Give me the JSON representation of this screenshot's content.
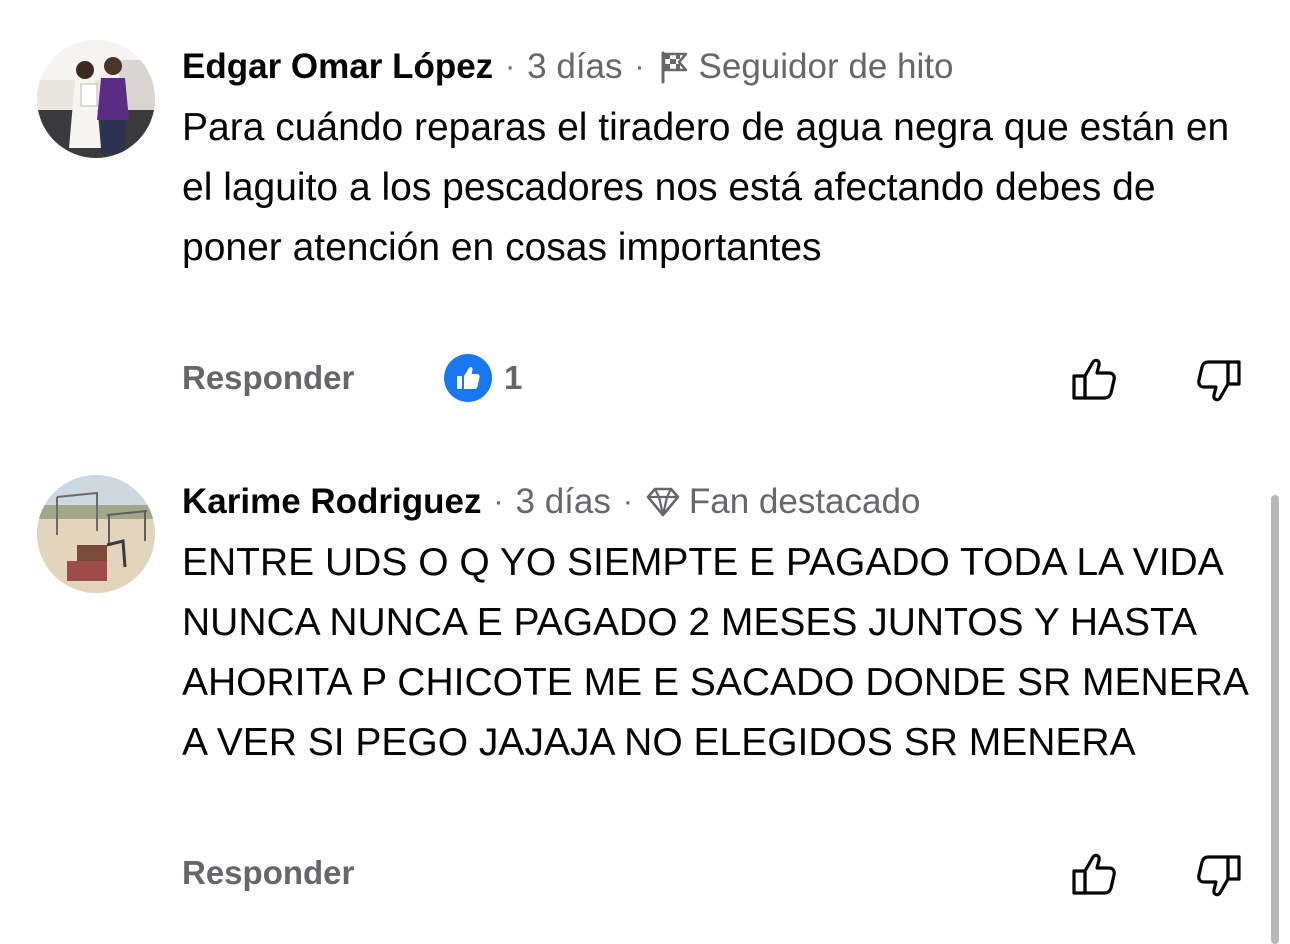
{
  "comments": [
    {
      "author": "Edgar Omar López",
      "separator": "·",
      "time": "3 días",
      "badge_icon": "flag-icon",
      "badge_label": "Seguidor de hito",
      "text": "Para cuándo reparas el tiradero de agua negra que están en el laguito a los pescadores nos está afectando debes de poner atención en cosas importantes",
      "reply_label": "Responder",
      "reaction_icon": "like-reaction-icon",
      "reaction_count": "1"
    },
    {
      "author": "Karime Rodriguez",
      "separator": "·",
      "time": "3 días",
      "badge_icon": "diamond-icon",
      "badge_label": "Fan destacado",
      "text": "ENTRE UDS O Q YO SIEMPTE E PAGADO TODA LA VIDA NUNCA NUNCA E PAGADO 2 MESES JUNTOS Y HASTA AHORITA P CHICOTE ME E SACADO DONDE SR MENERA A VER SI PEGO JAJAJA NO ELEGIDOS SR MENERA",
      "reply_label": "Responder"
    }
  ],
  "colors": {
    "meta_gray": "#65676b",
    "text": "#050505",
    "like_blue": "#1877f2"
  }
}
